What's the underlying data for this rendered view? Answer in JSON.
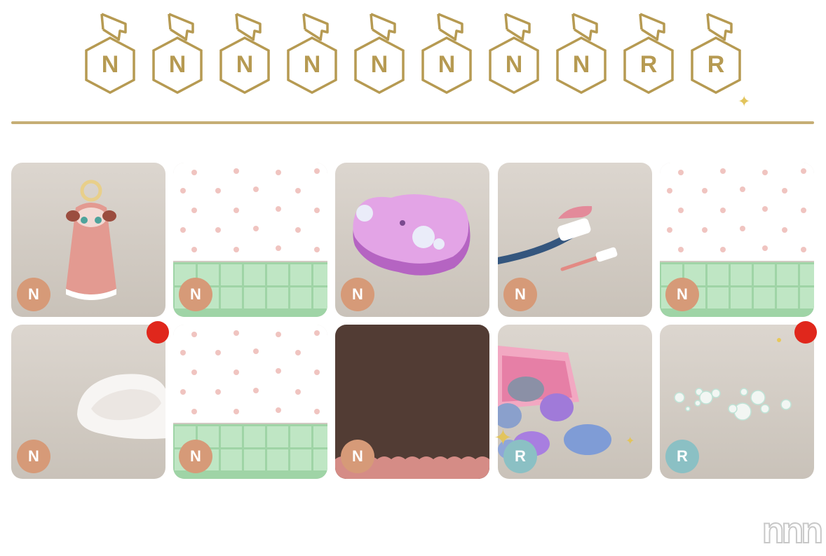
{
  "badges": [
    {
      "letter": "N"
    },
    {
      "letter": "N"
    },
    {
      "letter": "N"
    },
    {
      "letter": "N"
    },
    {
      "letter": "N"
    },
    {
      "letter": "N"
    },
    {
      "letter": "N"
    },
    {
      "letter": "N"
    },
    {
      "letter": "R"
    },
    {
      "letter": "R"
    }
  ],
  "cards": [
    {
      "item": "hanging-towel-doll",
      "rarity": "N",
      "new": false
    },
    {
      "item": "animal-wallpaper-green-tile",
      "rarity": "N",
      "new": false
    },
    {
      "item": "purple-bath-sponge",
      "rarity": "N",
      "new": false
    },
    {
      "item": "toothbrush-set",
      "rarity": "N",
      "new": false
    },
    {
      "item": "animal-wallpaper-green-tile",
      "rarity": "N",
      "new": false
    },
    {
      "item": "white-towel-ring",
      "rarity": "N",
      "new": true
    },
    {
      "item": "animal-wallpaper-green-tile",
      "rarity": "N",
      "new": false
    },
    {
      "item": "brown-bath-mat",
      "rarity": "N",
      "new": false
    },
    {
      "item": "bath-bomb-box",
      "rarity": "R",
      "new": false
    },
    {
      "item": "floating-bubbles",
      "rarity": "R",
      "new": true
    }
  ],
  "colors": {
    "gold": "#b69a52",
    "rarity_n": "#d69a78",
    "rarity_r": "#8bc0c4",
    "new_dot": "#e0271c"
  },
  "watermark": "nnn"
}
